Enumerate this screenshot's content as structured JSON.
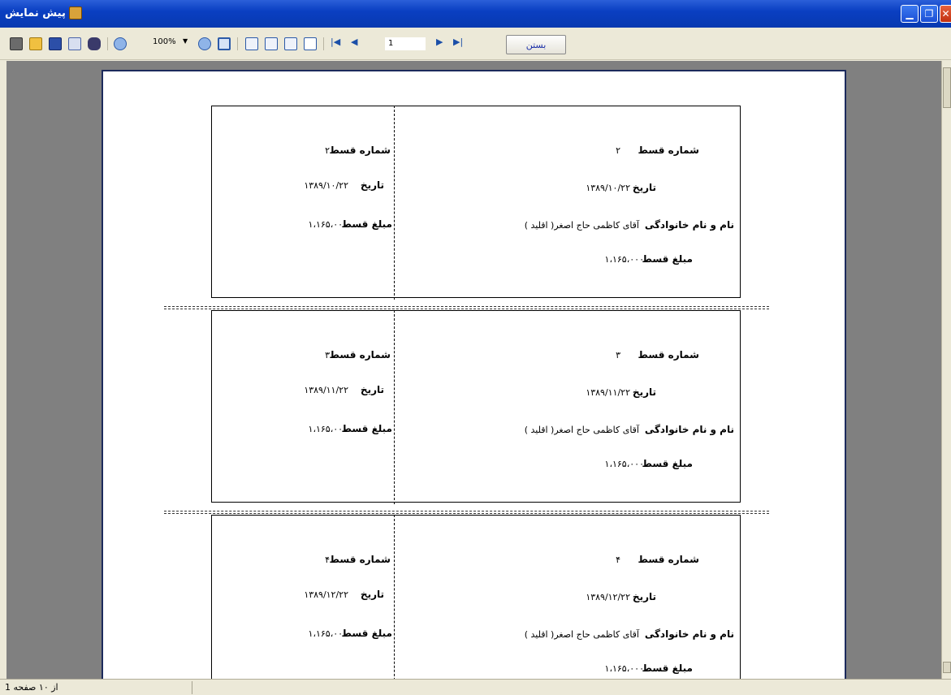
{
  "window": {
    "title": "پیش نمایش",
    "icon": "report-icon",
    "buttons": [
      "minimize",
      "restore",
      "close"
    ]
  },
  "toolbar": {
    "zoom": "100%",
    "page_input": "1",
    "close_label": "بستن",
    "icons": [
      "print-icon",
      "open-icon",
      "save-icon",
      "export-icon",
      "find-icon",
      "zoom-in-icon",
      "zoom-out-icon",
      "full-page-icon",
      "single-page-icon",
      "multi-page-icon",
      "book-icon",
      "edit-icon",
      "first-page-icon",
      "prev-page-icon",
      "next-page-icon",
      "last-page-icon"
    ]
  },
  "receipts": [
    {
      "stub": {
        "number_label": "شماره قسط",
        "number": "۲",
        "date_label": "تاریخ",
        "date": "۱۳۸۹/۱۰/۲۲",
        "amount_label": "مبلغ قسط",
        "amount": "۱،۱۶۵،۰۰۰"
      },
      "main": {
        "number_label": "شماره قسط",
        "number": "۲",
        "date_label": "تاریخ",
        "date": "۱۳۸۹/۱۰/۲۲",
        "name_label": "نام و نام خانوادگی",
        "name": "آقای کاظمی حاج اصغر( اقلید )",
        "amount_label": "مبلغ قسط",
        "amount": "۱،۱۶۵،۰۰۰"
      }
    },
    {
      "stub": {
        "number_label": "شماره قسط",
        "number": "۳",
        "date_label": "تاریخ",
        "date": "۱۳۸۹/۱۱/۲۲",
        "amount_label": "مبلغ قسط",
        "amount": "۱،۱۶۵،۰۰۰"
      },
      "main": {
        "number_label": "شماره قسط",
        "number": "۳",
        "date_label": "تاریخ",
        "date": "۱۳۸۹/۱۱/۲۲",
        "name_label": "نام و نام خانوادگی",
        "name": "آقای کاظمی حاج اصغر( اقلید )",
        "amount_label": "مبلغ قسط",
        "amount": "۱،۱۶۵،۰۰۰"
      }
    },
    {
      "stub": {
        "number_label": "شماره قسط",
        "number": "۴",
        "date_label": "تاریخ",
        "date": "۱۳۸۹/۱۲/۲۲",
        "amount_label": "مبلغ قسط",
        "amount": "۱،۱۶۵،۰۰۰"
      },
      "main": {
        "number_label": "شماره قسط",
        "number": "۴",
        "date_label": "تاریخ",
        "date": "۱۳۸۹/۱۲/۲۲",
        "name_label": "نام و نام خانوادگی",
        "name": "آقای کاظمی حاج اصغر( اقلید )",
        "amount_label": "مبلغ قسط",
        "amount": "۱،۱۶۵،۰۰۰"
      }
    }
  ],
  "status": {
    "page_info": "از ۱۰ صفحه 1"
  }
}
